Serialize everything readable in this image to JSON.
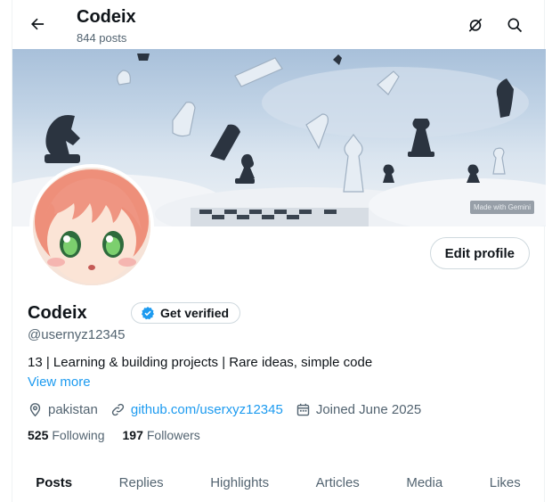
{
  "header": {
    "title": "Codeix",
    "post_count": "844 posts",
    "back_icon": "arrow-left-icon",
    "icons": [
      "no-notification-icon",
      "search-icon"
    ]
  },
  "banner": {
    "badge": "Made with Gemini"
  },
  "profile": {
    "name": "Codeix",
    "verify_label": "Get verified",
    "handle": "@usernyz12345",
    "bio": "13 | Learning & building projects | Rare ideas, simple code",
    "view_more": "View more",
    "location": "pakistan",
    "website": "github.com/userxyz12345",
    "joined": "Joined June 2025",
    "following_count": "525",
    "following_label": "Following",
    "followers_count": "197",
    "followers_label": "Followers",
    "edit_label": "Edit profile"
  },
  "tabs": [
    "Posts",
    "Replies",
    "Highlights",
    "Articles",
    "Media",
    "Likes"
  ],
  "colors": {
    "accent": "#1d9bf0",
    "text": "#0f1419",
    "secondary": "#536471",
    "border": "#cfd9de"
  }
}
